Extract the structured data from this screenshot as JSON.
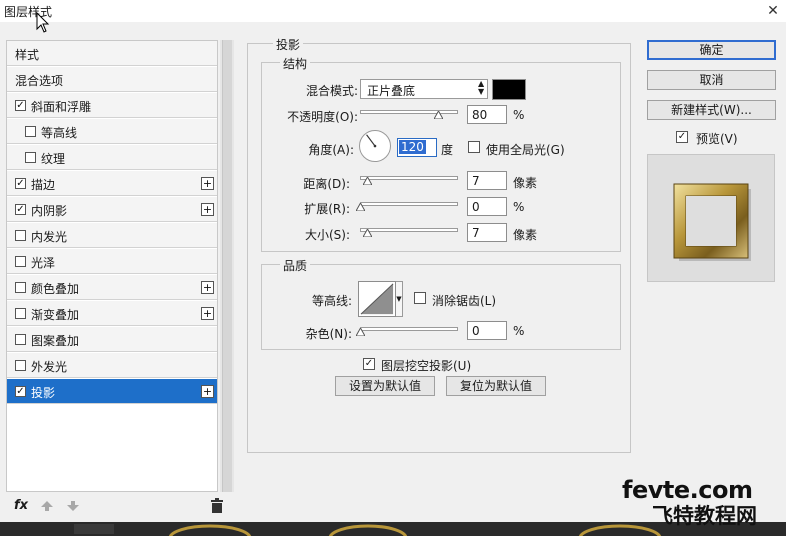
{
  "window": {
    "title": "图层样式",
    "close_glyph": "✕"
  },
  "style_list": {
    "items": [
      {
        "label": "样式",
        "checkbox": false,
        "checked": false,
        "plus": false,
        "indent": false,
        "selected": false
      },
      {
        "label": "混合选项",
        "checkbox": false,
        "checked": false,
        "plus": false,
        "indent": false,
        "selected": false
      },
      {
        "label": "斜面和浮雕",
        "checkbox": true,
        "checked": true,
        "plus": false,
        "indent": false,
        "selected": false
      },
      {
        "label": "等高线",
        "checkbox": true,
        "checked": false,
        "plus": false,
        "indent": true,
        "selected": false
      },
      {
        "label": "纹理",
        "checkbox": true,
        "checked": false,
        "plus": false,
        "indent": true,
        "selected": false
      },
      {
        "label": "描边",
        "checkbox": true,
        "checked": true,
        "plus": true,
        "indent": false,
        "selected": false
      },
      {
        "label": "内阴影",
        "checkbox": true,
        "checked": true,
        "plus": true,
        "indent": false,
        "selected": false
      },
      {
        "label": "内发光",
        "checkbox": true,
        "checked": false,
        "plus": false,
        "indent": false,
        "selected": false
      },
      {
        "label": "光泽",
        "checkbox": true,
        "checked": false,
        "plus": false,
        "indent": false,
        "selected": false
      },
      {
        "label": "颜色叠加",
        "checkbox": true,
        "checked": false,
        "plus": true,
        "indent": false,
        "selected": false
      },
      {
        "label": "渐变叠加",
        "checkbox": true,
        "checked": false,
        "plus": true,
        "indent": false,
        "selected": false
      },
      {
        "label": "图案叠加",
        "checkbox": true,
        "checked": false,
        "plus": false,
        "indent": false,
        "selected": false
      },
      {
        "label": "外发光",
        "checkbox": true,
        "checked": false,
        "plus": false,
        "indent": false,
        "selected": false
      },
      {
        "label": "投影",
        "checkbox": true,
        "checked": true,
        "plus": true,
        "indent": false,
        "selected": true
      }
    ],
    "fx_label": "fx",
    "check_glyph": "✓",
    "plus_glyph": "+"
  },
  "panel": {
    "section_title": "投影",
    "structure": {
      "title": "结构",
      "blend_mode_label": "混合模式:",
      "blend_mode_value": "正片叠底",
      "shadow_color": "#000000",
      "opacity_label": "不透明度(O):",
      "opacity_value": "80",
      "opacity_fraction": 0.8,
      "angle_label": "角度(A):",
      "angle_value": "120",
      "angle_unit": "度",
      "global_light_label": "使用全局光(G)",
      "global_light_checked": false,
      "distance_label": "距离(D):",
      "distance_value": "7",
      "distance_unit": "像素",
      "spread_label": "扩展(R):",
      "spread_value": "0",
      "size_label": "大小(S):",
      "size_value": "7",
      "size_unit": "像素",
      "percent": "%"
    },
    "quality": {
      "title": "品质",
      "contour_label": "等高线:",
      "antialias_label": "消除锯齿(L)",
      "antialias_checked": false,
      "noise_label": "杂色(N):",
      "noise_value": "0"
    },
    "knockout_label": "图层挖空投影(U)",
    "knockout_checked": true,
    "make_default_label": "设置为默认值",
    "reset_default_label": "复位为默认值"
  },
  "buttons": {
    "ok": "确定",
    "cancel": "取消",
    "new_style": "新建样式(W)...",
    "preview_label": "预览(V)",
    "preview_checked": true
  },
  "watermark": {
    "line1": "fevte.com",
    "line2": "飞特教程网"
  },
  "colors": {
    "selection": "#1e6fc9",
    "focus": "#2f6cd0",
    "gold": "#b8963a"
  }
}
